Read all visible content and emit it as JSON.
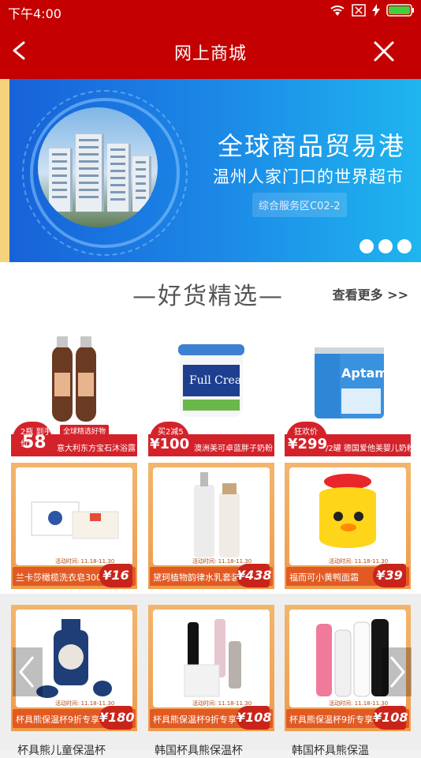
{
  "status": {
    "time": "下午4:00"
  },
  "header": {
    "title": "网上商城"
  },
  "banner": {
    "title": "全球商品贸易港",
    "subtitle": "温州人家门口的世界超市",
    "tag": "综合服务区C02-2",
    "dots": 3
  },
  "section": {
    "heading": "—好货精选—",
    "more": "查看更多 >>"
  },
  "featured": [
    {
      "badge_small": "2瓶 到手价",
      "price": "58",
      "currency": "¥",
      "desc": "意大利东方宝石沐浴露",
      "label": "全球精选好物"
    },
    {
      "badge_small": "买2减5",
      "price": "100",
      "currency": "¥",
      "desc": "澳洲美可卓蓝胖子奶粉"
    },
    {
      "badge_small": "狂欢价",
      "price": "299",
      "currency": "¥",
      "unit": "/2罐",
      "desc": "德国爱他美婴儿奶粉PRE"
    }
  ],
  "promos": [
    {
      "name": "兰卡莎橄榄洗衣皂300g",
      "price": "16",
      "time": "活动时间: 11.18-11.30"
    },
    {
      "name": "黛珂植物韵律水乳套装",
      "price": "438",
      "time": "活动时间: 11.18-11.30"
    },
    {
      "name": "福而可小黄鸭面霜",
      "price": "39",
      "time": "活动时间: 11.18-11.30"
    },
    {
      "name": "杯具熊保温杯9折专享",
      "price": "180",
      "time": "活动时间: 11.18-11.30"
    },
    {
      "name": "杯具熊保温杯9折专享",
      "price": "108",
      "time": "活动时间: 11.18-11.30"
    },
    {
      "name": "杯具熊保温杯9折专享",
      "price": "108",
      "time": "活动时间: 11.18-11.30"
    }
  ],
  "bottom_texts": [
    "杯具熊儿童保温杯",
    "韩国杯具熊保温杯",
    "韩国杯具熊保温"
  ],
  "colors": {
    "header": "#c40000",
    "price_red": "#d4222a",
    "promo_orange": "#ee9c4b"
  }
}
